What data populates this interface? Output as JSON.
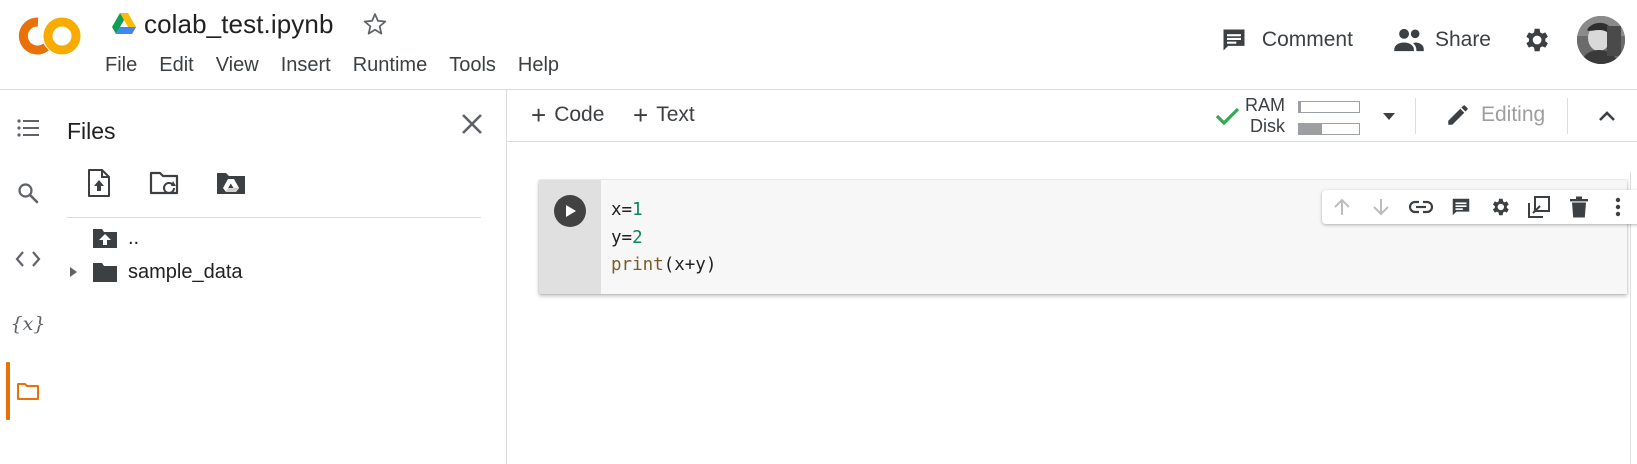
{
  "app": {
    "logo_text": "CO",
    "notebook_title": "colab_test.ipynb",
    "brand_color": "#f9ab00",
    "brand_color_secondary": "#e8710a"
  },
  "menu": {
    "items": [
      "File",
      "Edit",
      "View",
      "Insert",
      "Runtime",
      "Tools",
      "Help"
    ]
  },
  "header_actions": {
    "comment_label": "Comment",
    "share_label": "Share",
    "icons": [
      "comment-icon",
      "share-icon",
      "settings-icon",
      "avatar"
    ]
  },
  "left_rail": {
    "icons": [
      "table-of-contents-icon",
      "search-icon",
      "code-snippets-icon",
      "variables-icon",
      "files-icon"
    ],
    "variables_glyph": "{x}",
    "active": "files-icon"
  },
  "files_panel": {
    "title": "Files",
    "toolbar_icons": [
      "upload-icon",
      "refresh-folder-icon",
      "mount-drive-icon"
    ],
    "tree": [
      {
        "label": "..",
        "icon": "folder-up-icon"
      },
      {
        "label": "sample_data",
        "icon": "folder-icon",
        "expandable": true
      }
    ]
  },
  "notebook_toolbar": {
    "add_code_label": "Code",
    "add_text_label": "Text",
    "plus_glyph": "+",
    "resources": {
      "ram_label": "RAM",
      "disk_label": "Disk",
      "ram_usage": 0.03,
      "disk_usage": 0.38,
      "status": "connected"
    },
    "editing_label": "Editing"
  },
  "code_cell": {
    "lines": [
      {
        "var": "x=",
        "num": "1"
      },
      {
        "var": "y=",
        "num": "2"
      },
      {
        "fn": "print",
        "rest": "(x+y)"
      }
    ],
    "toolbar_icons": [
      "move-up-icon",
      "move-down-icon",
      "link-icon",
      "comment-icon",
      "settings-icon",
      "mirror-cell-icon",
      "delete-icon",
      "more-vert-icon"
    ]
  }
}
